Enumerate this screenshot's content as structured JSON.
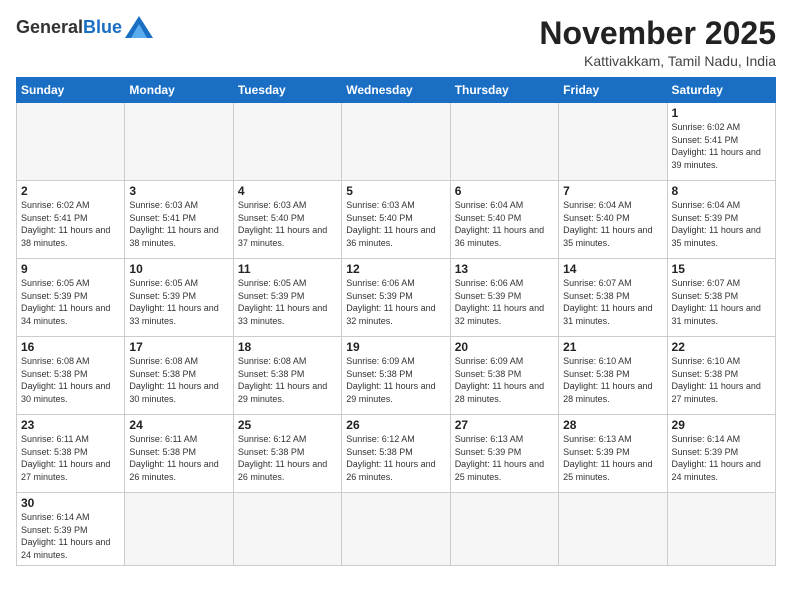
{
  "logo": {
    "general": "General",
    "blue": "Blue"
  },
  "title": "November 2025",
  "location": "Kattivakkam, Tamil Nadu, India",
  "weekdays": [
    "Sunday",
    "Monday",
    "Tuesday",
    "Wednesday",
    "Thursday",
    "Friday",
    "Saturday"
  ],
  "weeks": [
    [
      {
        "day": "",
        "info": ""
      },
      {
        "day": "",
        "info": ""
      },
      {
        "day": "",
        "info": ""
      },
      {
        "day": "",
        "info": ""
      },
      {
        "day": "",
        "info": ""
      },
      {
        "day": "",
        "info": ""
      },
      {
        "day": "1",
        "info": "Sunrise: 6:02 AM\nSunset: 5:41 PM\nDaylight: 11 hours\nand 39 minutes."
      }
    ],
    [
      {
        "day": "2",
        "info": "Sunrise: 6:02 AM\nSunset: 5:41 PM\nDaylight: 11 hours\nand 38 minutes."
      },
      {
        "day": "3",
        "info": "Sunrise: 6:03 AM\nSunset: 5:41 PM\nDaylight: 11 hours\nand 38 minutes."
      },
      {
        "day": "4",
        "info": "Sunrise: 6:03 AM\nSunset: 5:40 PM\nDaylight: 11 hours\nand 37 minutes."
      },
      {
        "day": "5",
        "info": "Sunrise: 6:03 AM\nSunset: 5:40 PM\nDaylight: 11 hours\nand 36 minutes."
      },
      {
        "day": "6",
        "info": "Sunrise: 6:04 AM\nSunset: 5:40 PM\nDaylight: 11 hours\nand 36 minutes."
      },
      {
        "day": "7",
        "info": "Sunrise: 6:04 AM\nSunset: 5:40 PM\nDaylight: 11 hours\nand 35 minutes."
      },
      {
        "day": "8",
        "info": "Sunrise: 6:04 AM\nSunset: 5:39 PM\nDaylight: 11 hours\nand 35 minutes."
      }
    ],
    [
      {
        "day": "9",
        "info": "Sunrise: 6:05 AM\nSunset: 5:39 PM\nDaylight: 11 hours\nand 34 minutes."
      },
      {
        "day": "10",
        "info": "Sunrise: 6:05 AM\nSunset: 5:39 PM\nDaylight: 11 hours\nand 33 minutes."
      },
      {
        "day": "11",
        "info": "Sunrise: 6:05 AM\nSunset: 5:39 PM\nDaylight: 11 hours\nand 33 minutes."
      },
      {
        "day": "12",
        "info": "Sunrise: 6:06 AM\nSunset: 5:39 PM\nDaylight: 11 hours\nand 32 minutes."
      },
      {
        "day": "13",
        "info": "Sunrise: 6:06 AM\nSunset: 5:39 PM\nDaylight: 11 hours\nand 32 minutes."
      },
      {
        "day": "14",
        "info": "Sunrise: 6:07 AM\nSunset: 5:38 PM\nDaylight: 11 hours\nand 31 minutes."
      },
      {
        "day": "15",
        "info": "Sunrise: 6:07 AM\nSunset: 5:38 PM\nDaylight: 11 hours\nand 31 minutes."
      }
    ],
    [
      {
        "day": "16",
        "info": "Sunrise: 6:08 AM\nSunset: 5:38 PM\nDaylight: 11 hours\nand 30 minutes."
      },
      {
        "day": "17",
        "info": "Sunrise: 6:08 AM\nSunset: 5:38 PM\nDaylight: 11 hours\nand 30 minutes."
      },
      {
        "day": "18",
        "info": "Sunrise: 6:08 AM\nSunset: 5:38 PM\nDaylight: 11 hours\nand 29 minutes."
      },
      {
        "day": "19",
        "info": "Sunrise: 6:09 AM\nSunset: 5:38 PM\nDaylight: 11 hours\nand 29 minutes."
      },
      {
        "day": "20",
        "info": "Sunrise: 6:09 AM\nSunset: 5:38 PM\nDaylight: 11 hours\nand 28 minutes."
      },
      {
        "day": "21",
        "info": "Sunrise: 6:10 AM\nSunset: 5:38 PM\nDaylight: 11 hours\nand 28 minutes."
      },
      {
        "day": "22",
        "info": "Sunrise: 6:10 AM\nSunset: 5:38 PM\nDaylight: 11 hours\nand 27 minutes."
      }
    ],
    [
      {
        "day": "23",
        "info": "Sunrise: 6:11 AM\nSunset: 5:38 PM\nDaylight: 11 hours\nand 27 minutes."
      },
      {
        "day": "24",
        "info": "Sunrise: 6:11 AM\nSunset: 5:38 PM\nDaylight: 11 hours\nand 26 minutes."
      },
      {
        "day": "25",
        "info": "Sunrise: 6:12 AM\nSunset: 5:38 PM\nDaylight: 11 hours\nand 26 minutes."
      },
      {
        "day": "26",
        "info": "Sunrise: 6:12 AM\nSunset: 5:38 PM\nDaylight: 11 hours\nand 26 minutes."
      },
      {
        "day": "27",
        "info": "Sunrise: 6:13 AM\nSunset: 5:39 PM\nDaylight: 11 hours\nand 25 minutes."
      },
      {
        "day": "28",
        "info": "Sunrise: 6:13 AM\nSunset: 5:39 PM\nDaylight: 11 hours\nand 25 minutes."
      },
      {
        "day": "29",
        "info": "Sunrise: 6:14 AM\nSunset: 5:39 PM\nDaylight: 11 hours\nand 24 minutes."
      }
    ],
    [
      {
        "day": "30",
        "info": "Sunrise: 6:14 AM\nSunset: 5:39 PM\nDaylight: 11 hours\nand 24 minutes."
      },
      {
        "day": "",
        "info": ""
      },
      {
        "day": "",
        "info": ""
      },
      {
        "day": "",
        "info": ""
      },
      {
        "day": "",
        "info": ""
      },
      {
        "day": "",
        "info": ""
      },
      {
        "day": "",
        "info": ""
      }
    ]
  ]
}
